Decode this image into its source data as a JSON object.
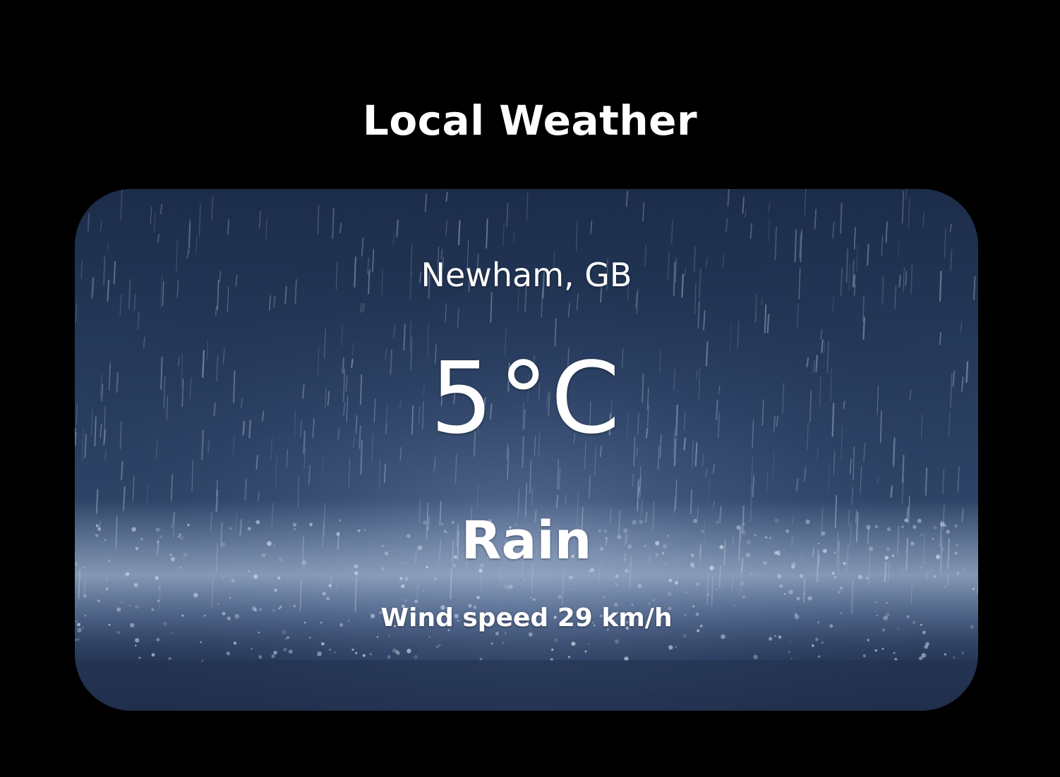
{
  "app": {
    "title": "Local Weather"
  },
  "weather": {
    "location": "Newham, GB",
    "temperature_value": "5",
    "temperature_unit": "°C",
    "condition": "Rain",
    "wind_label": "Wind speed",
    "wind_value": "29 km/h",
    "background_scene": "rain"
  },
  "colors": {
    "page_background": "#000000",
    "text": "#ffffff",
    "card_tint": "#2f4669"
  }
}
